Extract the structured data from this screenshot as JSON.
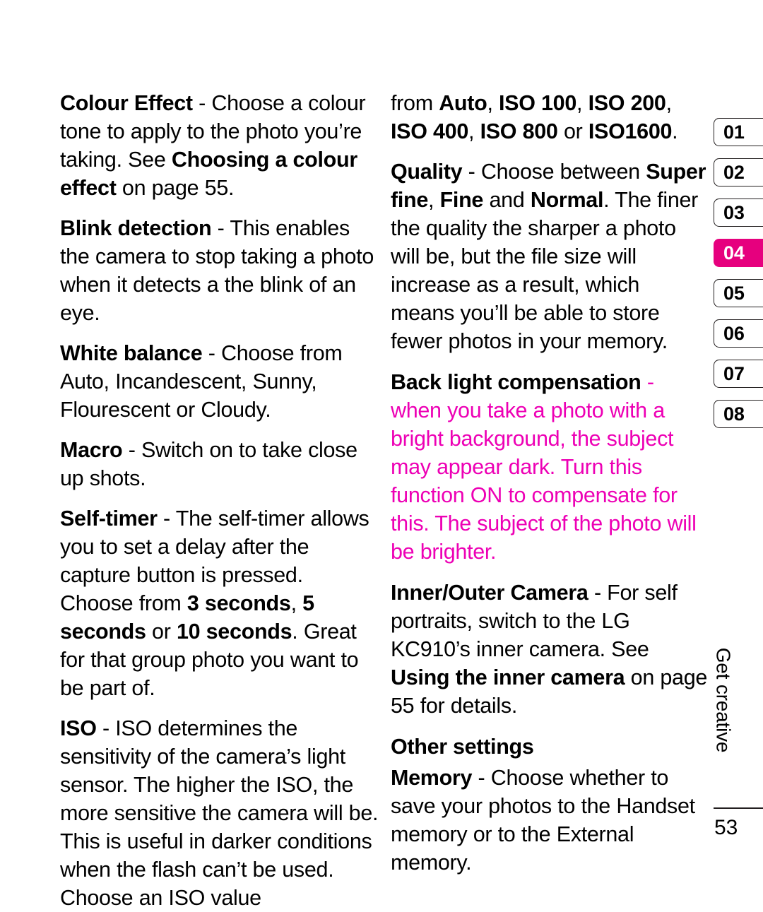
{
  "document": {
    "page_number": "53",
    "running_head": "Get creative",
    "accent_color": "#E6007E",
    "highlight_text_color": "#ED00B5"
  },
  "tabs": [
    {
      "label": "01",
      "active": false
    },
    {
      "label": "02",
      "active": false
    },
    {
      "label": "03",
      "active": false
    },
    {
      "label": "04",
      "active": true
    },
    {
      "label": "05",
      "active": false
    },
    {
      "label": "06",
      "active": false
    },
    {
      "label": "07",
      "active": false
    },
    {
      "label": "08",
      "active": false
    }
  ],
  "left_column": {
    "colour_effect": {
      "term": "Colour Effect",
      "body_1": " - Choose a colour tone to apply to the photo you’re taking. See ",
      "ref": "Choosing a colour effect",
      "body_2": " on page 55."
    },
    "blink_detection": {
      "term": "Blink detection",
      "body": " - This enables the camera to stop taking a photo when it detects a the blink of an eye."
    },
    "white_balance": {
      "term": "White balance",
      "body": " - Choose from Auto, Incandescent, Sunny, Flourescent or Cloudy."
    },
    "macro": {
      "term": "Macro",
      "body": " - Switch on to take close up shots."
    },
    "self_timer": {
      "term": "Self-timer",
      "body_1": " - The self-timer allows you to set a delay after the capture button is pressed. Choose from ",
      "opt_1": "3 seconds",
      "sep_1": ", ",
      "opt_2": "5 seconds",
      "sep_2": " or ",
      "opt_3": "10 seconds",
      "body_2": ". Great for that group photo you want to be part of."
    },
    "iso": {
      "term": "ISO",
      "body": " - ISO determines the sensitivity of the camera’s light sensor. The higher the ISO, the more sensitive the camera will be. This is useful in darker conditions when the flash can’t be used. Choose an ISO value"
    }
  },
  "right_column": {
    "iso_continued": {
      "lead": "from ",
      "opt_1": "Auto",
      "sep_1": ", ",
      "opt_2": "ISO 100",
      "sep_2": ", ",
      "opt_3": "ISO 200",
      "sep_3": ", ",
      "opt_4": "ISO 400",
      "sep_4": ", ",
      "opt_5": "ISO 800",
      "sep_5": " or ",
      "opt_6": "ISO1600",
      "tail": "."
    },
    "quality": {
      "term": "Quality ",
      "body_1": " - Choose between ",
      "opt_1": "Super fine",
      "sep_1": ", ",
      "opt_2": "Fine",
      "sep_2": " and ",
      "opt_3": "Normal",
      "body_2": ". The finer the quality the sharper a photo will be, but the file size will increase as a result, which means you’ll be able to store fewer photos in your memory."
    },
    "back_light_compensation": {
      "term": "Back light compensation ",
      "body": " - when you take a photo with a bright background, the subject may appear dark. Turn this function ON to compensate for this. The subject of the photo will be brighter."
    },
    "inner_outer_camera": {
      "term": "Inner/Outer Camera ",
      "body_1": " - For self portraits, switch to the LG KC910’s inner camera. See ",
      "ref": "Using the inner camera",
      "body_2": " on page 55 for details."
    },
    "other_settings_heading": "Other settings",
    "memory": {
      "term": "Memory",
      "body": " - Choose whether to save your photos to the Handset memory or to the External memory."
    }
  }
}
